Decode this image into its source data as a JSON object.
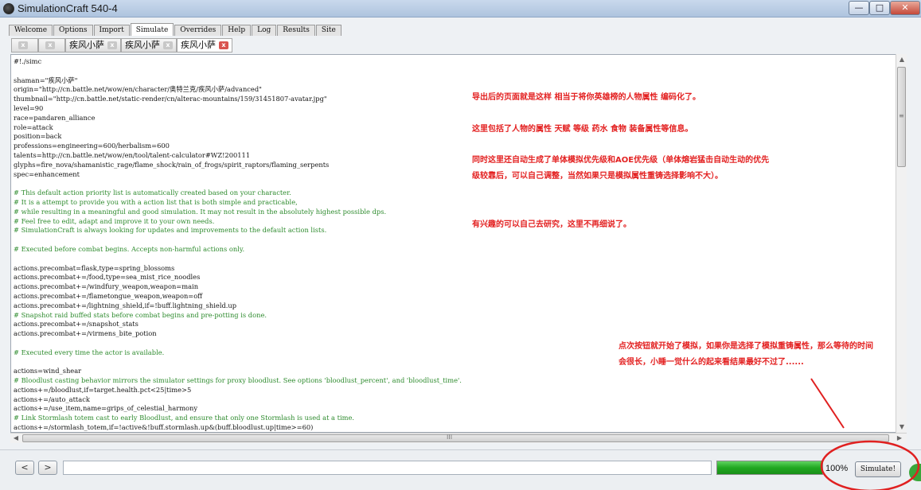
{
  "window": {
    "title": "SimulationCraft 540-4",
    "controls": [
      "—",
      "□",
      "✕"
    ]
  },
  "main_tabs": [
    {
      "label": "Welcome",
      "active": false
    },
    {
      "label": "Options",
      "active": false
    },
    {
      "label": "Import",
      "active": false
    },
    {
      "label": "Simulate",
      "active": true
    },
    {
      "label": "Overrides",
      "active": false
    },
    {
      "label": "Help",
      "active": false
    },
    {
      "label": "Log",
      "active": false
    },
    {
      "label": "Results",
      "active": false
    },
    {
      "label": "Site",
      "active": false
    }
  ],
  "sub_tabs": [
    {
      "label": "",
      "close": "x"
    },
    {
      "label": "",
      "close": "x"
    },
    {
      "label": "疾风小萨",
      "close": "x"
    },
    {
      "label": "疾风小萨",
      "close": "x"
    },
    {
      "label": "疾风小萨",
      "close": "x",
      "active": true
    }
  ],
  "editor_lines": [
    {
      "text": "#!./simc",
      "comment": false
    },
    {
      "text": "",
      "comment": false
    },
    {
      "text": "shaman=\"疾风小萨\"",
      "comment": false
    },
    {
      "text": "origin=\"http://cn.battle.net/wow/en/character/奥特兰克/疾风小萨/advanced\"",
      "comment": false
    },
    {
      "text": "thumbnail=\"http://cn.battle.net/static-render/cn/alterac-mountains/159/31451807-avatar.jpg\"",
      "comment": false
    },
    {
      "text": "level=90",
      "comment": false
    },
    {
      "text": "race=pandaren_alliance",
      "comment": false
    },
    {
      "text": "role=attack",
      "comment": false
    },
    {
      "text": "position=back",
      "comment": false
    },
    {
      "text": "professions=engineering=600/herbalism=600",
      "comment": false
    },
    {
      "text": "talents=http://cn.battle.net/wow/en/tool/talent-calculator#WZ!200111",
      "comment": false
    },
    {
      "text": "glyphs=fire_nova/shamanistic_rage/flame_shock/rain_of_frogs/spirit_raptors/flaming_serpents",
      "comment": false
    },
    {
      "text": "spec=enhancement",
      "comment": false
    },
    {
      "text": "",
      "comment": false
    },
    {
      "text": "# This default action priority list is automatically created based on your character.",
      "comment": true
    },
    {
      "text": "# It is a attempt to provide you with a action list that is both simple and practicable,",
      "comment": true
    },
    {
      "text": "# while resulting in a meaningful and good simulation. It may not result in the absolutely highest possible dps.",
      "comment": true
    },
    {
      "text": "# Feel free to edit, adapt and improve it to your own needs.",
      "comment": true
    },
    {
      "text": "# SimulationCraft is always looking for updates and improvements to the default action lists.",
      "comment": true
    },
    {
      "text": "",
      "comment": false
    },
    {
      "text": "# Executed before combat begins. Accepts non-harmful actions only.",
      "comment": true
    },
    {
      "text": "",
      "comment": false
    },
    {
      "text": "actions.precombat=flask,type=spring_blossoms",
      "comment": false
    },
    {
      "text": "actions.precombat+=/food,type=sea_mist_rice_noodles",
      "comment": false
    },
    {
      "text": "actions.precombat+=/windfury_weapon,weapon=main",
      "comment": false
    },
    {
      "text": "actions.precombat+=/flametongue_weapon,weapon=off",
      "comment": false
    },
    {
      "text": "actions.precombat+=/lightning_shield,if=!buff.lightning_shield.up",
      "comment": false
    },
    {
      "text": "# Snapshot raid buffed stats before combat begins and pre-potting is done.",
      "comment": true
    },
    {
      "text": "actions.precombat+=/snapshot_stats",
      "comment": false
    },
    {
      "text": "actions.precombat+=/virmens_bite_potion",
      "comment": false
    },
    {
      "text": "",
      "comment": false
    },
    {
      "text": "# Executed every time the actor is available.",
      "comment": true
    },
    {
      "text": "",
      "comment": false
    },
    {
      "text": "actions=wind_shear",
      "comment": false
    },
    {
      "text": "# Bloodlust casting behavior mirrors the simulator settings for proxy bloodlust. See options 'bloodlust_percent', and 'bloodlust_time'.",
      "comment": true
    },
    {
      "text": "actions+=/bloodlust,if=target.health.pct<25|time>5",
      "comment": false
    },
    {
      "text": "actions+=/auto_attack",
      "comment": false
    },
    {
      "text": "actions+=/use_item,name=grips_of_celestial_harmony",
      "comment": false
    },
    {
      "text": "# Link Stormlash totem cast to early Bloodlust, and ensure that only one Stormlash is used at a time.",
      "comment": true
    },
    {
      "text": "actions+=/stormlash_totem,if=!active&!buff.stormlash.up&(buff.bloodlust.up|time>=60)",
      "comment": false
    }
  ],
  "annotations": {
    "note1": "导出后的页面就是这样 相当于将你英雄榜的人物属性 编码化了。",
    "note2": "这里包括了人物的属性 天赋 等级 药水 食物 装备属性等信息。",
    "note3": "同时这里还自动生成了单体模拟优先级和AOE优先级（单体熔岩猛击自动生动的优先级较靠后，可以自己调整，当然如果只是模拟属性重铸选择影响不大）。",
    "note4": "有兴趣的可以自己去研究，这里不再细说了。",
    "note5": "点次按钮就开始了模拟，如果你是选择了模拟重铸属性，那么等待的时间会很长，小睡一觉什么的起来看结果最好不过了......"
  },
  "scrollbar": {
    "h_grip": "III",
    "v_grip": "≡"
  },
  "bottom": {
    "back": "<",
    "forward": ">",
    "url_value": "",
    "progress_fraction": 1.0,
    "progress_text": "100%",
    "simulate_label": "Simulate!"
  },
  "colors": {
    "annotation": "#e32121",
    "comment": "#2e8b2e",
    "progress": "#21a821"
  }
}
